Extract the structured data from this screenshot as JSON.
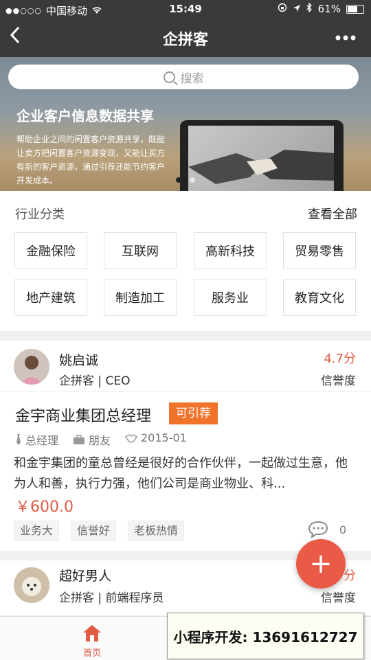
{
  "status_bar": {
    "signal_dots": "●●○○○",
    "carrier": "中国移动",
    "time": "15:49",
    "battery": "61%"
  },
  "nav": {
    "title": "企拼客",
    "back_icon": "chevron-left-icon",
    "more_icon": "more-icon"
  },
  "banner": {
    "search_placeholder": "搜索",
    "title": "企业客户信息数据共享",
    "description": "帮助企业之间的闲置客户资源共享，既能让卖方把闲置客户资源变现，又能让买方有新的客户资源，通过引荐还能节约客户开发成本。",
    "slides_count": 2,
    "active_slide": 1
  },
  "industry": {
    "title": "行业分类",
    "view_all": "查看全部",
    "categories": [
      "金融保险",
      "互联网",
      "高新科技",
      "贸易零售",
      "地产建筑",
      "制造加工",
      "服务业",
      "教育文化"
    ]
  },
  "posts": [
    {
      "name": "姚启诚",
      "company": "企拼客 | CEO",
      "score": "4.7分",
      "credit_label": "信誉度",
      "title": "金宇商业集团总经理",
      "badge": "可引荐",
      "position": "总经理",
      "relation": "朋友",
      "since": "2015-01",
      "description": "和金宇集团的童总曾经是很好的合作伙伴，一起做过生意，他为人和善，执行力强，他们公司是商业物业、科...",
      "price": "￥600.0",
      "tags": [
        "业务大",
        "信誉好",
        "老板热情"
      ],
      "comments": "0"
    },
    {
      "name": "超好男人",
      "company": "企拼客 | 前端程序员",
      "score": "分",
      "credit_label": "信誉度"
    }
  ],
  "fab": {
    "label": "+"
  },
  "tabbar": {
    "home_label": "首页"
  },
  "overlay": {
    "text": "小程序开发: 13691612727"
  },
  "colors": {
    "accent": "#e15b45",
    "badge": "#f0732c",
    "navbar": "#3a3a3a"
  }
}
